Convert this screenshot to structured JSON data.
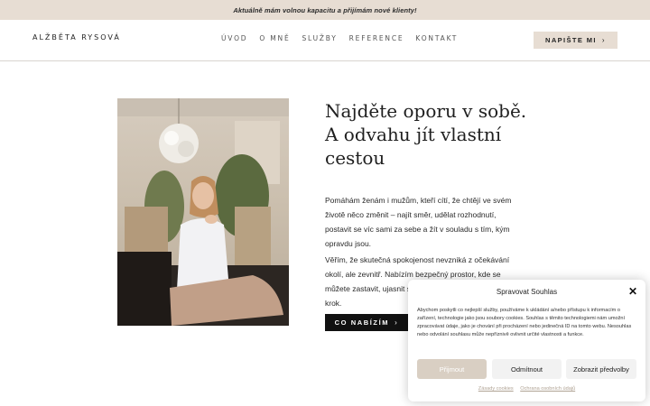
{
  "announcement": "Aktuálně mám volnou kapacitu a přijímám nové klienty!",
  "header": {
    "logo": "ALŽBĚTA RYSOVÁ",
    "nav": [
      "ÚVOD",
      "O MNĚ",
      "SLUŽBY",
      "REFERENCE",
      "KONTAKT"
    ],
    "cta_label": "NAPIŠTE MI"
  },
  "hero": {
    "title": "Najděte oporu v sobě. A odvahu jít vlastní cestou",
    "paragraph1": "Pomáhám ženám i mužům, kteří cítí, že chtějí ve svém životě něco změnit – najít směr, udělat rozhodnutí, postavit se víc sami za sebe a žít v souladu s tím, kým opravdu jsou.",
    "paragraph2": "Věřím, že skutečná spokojenost nevzniká z očekávání okolí, ale zevnitř. Nabízím bezpečný prostor, kde se můžete zastavit, ujasnit si, co potřebujete, a udělat další krok.",
    "button_label": "CO NABÍZÍM"
  },
  "cookie": {
    "title": "Spravovat Souhlas",
    "text": "Abychom poskytli co nejlepší služby, používáme k ukládání a/nebo přístupu k informacím o zařízení, technologie jako jsou soubory cookies. Souhlas s těmito technologiemi nám umožní zpracovávat údaje, jako je chování při procházení nebo jedinečná ID na tomto webu. Nesouhlas nebo odvolání souhlasu může nepříznivě ovlivnit určité vlastnosti a funkce.",
    "accept_label": "Přijmout",
    "deny_label": "Odmítnout",
    "prefs_label": "Zobrazit předvolby",
    "link1": "Zásady cookies",
    "link2": "Ochrana osobních údajů"
  },
  "colors": {
    "accent": "#e7ddd3",
    "dark": "#111111"
  },
  "icons": {
    "cta_chevron": "chevron-right-icon",
    "close": "close-icon"
  }
}
